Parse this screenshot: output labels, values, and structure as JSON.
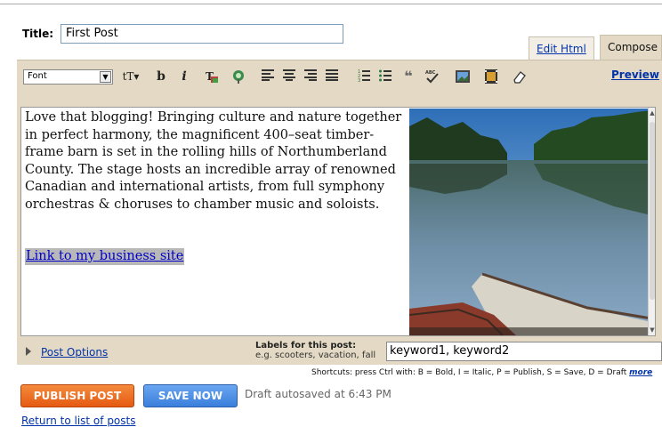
{
  "form": {
    "title_label": "Title:",
    "title_value": "First Post"
  },
  "tabs": {
    "edit_html": "Edit Html",
    "compose": "Compose"
  },
  "toolbar": {
    "font_label": "Font",
    "preview_label": "Preview",
    "icons": [
      "text-size-icon",
      "bold-icon",
      "italic-icon",
      "text-color-icon",
      "link-icon",
      "align-left-icon",
      "align-center-icon",
      "align-right-icon",
      "justify-icon",
      "numbered-list-icon",
      "bullet-list-icon",
      "blockquote-icon",
      "spellcheck-icon",
      "image-icon",
      "video-icon",
      "eraser-icon"
    ]
  },
  "editor": {
    "body_text": "Love that blogging! Bringing culture and nature together in perfect harmony, the magnificent 400–seat timber-frame barn is set in the rolling hills of Northumberland County. The stage hosts an incredible array of renowned Canadian and international artists, from full symphony orchestras & choruses to chamber music and soloists.",
    "link_text": "Link to my business site"
  },
  "options": {
    "post_options_label": "Post Options",
    "labels_title": "Labels for this post:",
    "labels_example": "e.g. scooters, vacation, fall",
    "labels_value": "keyword1, keyword2"
  },
  "shortcuts": {
    "text": "Shortcuts: press Ctrl with: B = Bold, I = Italic, P = Publish, S = Save, D = Draft",
    "more_label": "more"
  },
  "actions": {
    "publish_label": "PUBLISH POST",
    "save_label": "SAVE NOW",
    "autosave_status": "Draft autosaved at 6:43 PM",
    "return_label": "Return to list of posts"
  },
  "colors": {
    "toolbar_bg": "#e3d9c4",
    "publish": "#ef6f24",
    "save": "#4a8fe6",
    "link": "#0033aa"
  }
}
